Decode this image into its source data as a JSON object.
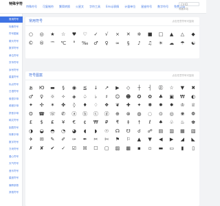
{
  "header": {
    "logo": "特殊字符",
    "nav": [
      "特殊符号",
      "可复制符",
      "繁简转换",
      "火星文",
      "字符工具",
      "Emoji表情",
      "计量单位",
      "星座符号",
      "数字符号",
      "免费字体"
    ],
    "search_label": "CtrlD",
    "sub_label": "收藏本站"
  },
  "sidebar": {
    "items": [
      {
        "label": "常用符号",
        "active": true
      },
      {
        "label": "特殊符号",
        "active": false
      },
      {
        "label": "符号图案",
        "active": false
      },
      {
        "label": "箭头符号",
        "active": false
      },
      {
        "label": "数学符号",
        "active": false
      },
      {
        "label": "单位符号",
        "active": false
      },
      {
        "label": "货币符号",
        "active": false
      },
      {
        "label": "序号符号",
        "active": false
      },
      {
        "label": "星星符号",
        "active": false
      },
      {
        "label": "标点符号",
        "active": false
      },
      {
        "label": "日语符号",
        "active": false
      },
      {
        "label": "俄语字母",
        "active": false
      },
      {
        "label": "希腊字母",
        "active": false
      },
      {
        "label": "拼音字母",
        "active": false
      },
      {
        "label": "韩文符号",
        "active": false
      },
      {
        "label": "制表符号",
        "active": false
      },
      {
        "label": "特殊字母",
        "active": false
      },
      {
        "label": "数字符号",
        "active": false
      },
      {
        "label": "方块符号",
        "active": false
      },
      {
        "label": "爱心符号",
        "active": false
      },
      {
        "label": "天气符号",
        "active": false
      },
      {
        "label": "音乐符号",
        "active": false
      },
      {
        "label": "星座符号",
        "active": false
      },
      {
        "label": "偏旁部首",
        "active": false
      },
      {
        "label": "其他符号",
        "active": false
      }
    ]
  },
  "common": {
    "title": "常用符号",
    "hint": "点击任意符号可复制",
    "symbols": [
      "○",
      "◎",
      "★",
      "☆",
      "♥",
      "♡",
      "✓",
      "√",
      "×",
      "✕",
      "※",
      "■",
      "□",
      "▲",
      "△",
      "◆",
      "©",
      "®",
      "™",
      "℃",
      "°",
      "‰",
      "♂",
      "♀",
      "∞",
      "§",
      "♪",
      "♫",
      "☀",
      "☁",
      "☂",
      "☯"
    ]
  },
  "patterns": {
    "title": "符号图案",
    "hint": "点击任意符号可复制",
    "symbols": [
      "ぁ",
      "Ю",
      "▬",
      "§",
      "◉",
      "≦",
      "↓",
      "↗",
      "▶",
      "◇",
      "┼",
      "┤",
      "㊣",
      "☆",
      "▼",
      "✖",
      "♂",
      "♀",
      "☼",
      "✧",
      "◈",
      "♤",
      "♭",
      "♯",
      "☺",
      "☻",
      "✪",
      "✿",
      "♣",
      "▣",
      "₩",
      "◐",
      "✦",
      "✣",
      "✶",
      "✤",
      "◊",
      "♦",
      "♢",
      "❖",
      "❦",
      "✚",
      "✦",
      "✺",
      "✹",
      "✸",
      "♔",
      "♕",
      "ʘ",
      "☎",
      "☏",
      "✆",
      "ⓐ",
      "ⓑ",
      "ⓒ",
      "ⓓ",
      "⊕",
      "⊗",
      "◍",
      "◌",
      "⊙",
      "◎",
      "❀",
      "❁",
      "£",
      "$",
      "₤",
      "¥",
      "€",
      "¢",
      "₩",
      "₽",
      "₹",
      "‡",
      "†",
      "ℓ",
      "♠",
      "♧",
      "♨",
      "♚",
      "◑",
      "◒",
      "◓",
      "◔",
      "◕",
      "◖",
      "◗",
      "☉",
      "☊",
      "☋",
      "☌",
      "☍",
      "▤",
      "▥",
      "▦",
      "▧",
      "✈",
      "✉",
      "✎",
      "✐",
      "✑",
      "✒",
      "✂",
      "✄",
      "⚑",
      "⚐",
      "▲",
      "▼",
      "◀",
      "▶",
      "◢",
      "◣",
      "✗",
      "✘",
      "✔",
      "✓",
      "☑",
      "☒",
      "☐",
      "▢",
      "▨",
      "▩",
      "▪",
      "▫",
      "▬",
      "▭",
      "▮",
      "▯"
    ]
  }
}
